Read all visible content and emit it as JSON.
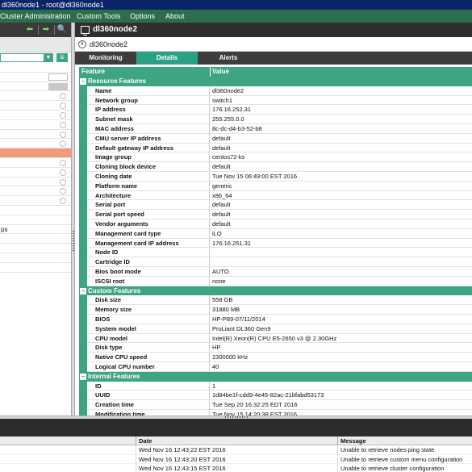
{
  "window": {
    "title": "dl360node1 - root@dl360node1"
  },
  "menubar": {
    "items": [
      "Cluster Administration",
      "Custom Tools",
      "Options",
      "About"
    ]
  },
  "left_panel": {
    "tree_partial_text": "ps"
  },
  "node": {
    "name": "dl360node2",
    "info_label": "dl360node2"
  },
  "tabs": [
    {
      "label": "Monitoring",
      "active": false
    },
    {
      "label": "Details",
      "active": true
    },
    {
      "label": "Alerts",
      "active": false
    }
  ],
  "grid": {
    "columns": [
      "Feature",
      "Value"
    ],
    "sections": [
      {
        "title": "Resource Features",
        "rows": [
          {
            "k": "Name",
            "v": "dl360node2"
          },
          {
            "k": "Network group",
            "v": "switch1"
          },
          {
            "k": "IP address",
            "v": "176.16.252.31"
          },
          {
            "k": "Subnet mask",
            "v": "255.255.0.0"
          },
          {
            "k": "MAC address",
            "v": "8c-dc-d4-b3-52-b8"
          },
          {
            "k": "CMU server IP address",
            "v": "default"
          },
          {
            "k": "Default gateway IP address",
            "v": "default"
          },
          {
            "k": "Image group",
            "v": "centos72-ks"
          },
          {
            "k": "Cloning block device",
            "v": "default"
          },
          {
            "k": "Cloning date",
            "v": "Tue Nov 15 06:49:00 EST 2016"
          },
          {
            "k": "Platform name",
            "v": "generic"
          },
          {
            "k": "Architecture",
            "v": "x86_64"
          },
          {
            "k": "Serial port",
            "v": "default"
          },
          {
            "k": "Serial port speed",
            "v": "default"
          },
          {
            "k": "Vendor arguments",
            "v": "default"
          },
          {
            "k": "Management card type",
            "v": "iLO"
          },
          {
            "k": "Management card IP address",
            "v": "176.16.251.31"
          },
          {
            "k": "Node ID",
            "v": ""
          },
          {
            "k": "Cartridge ID",
            "v": ""
          },
          {
            "k": "Bios boot mode",
            "v": "AUTO"
          },
          {
            "k": "ISCSI root",
            "v": "none"
          }
        ]
      },
      {
        "title": "Custom Features",
        "rows": [
          {
            "k": "Disk size",
            "v": "558 GB"
          },
          {
            "k": "Memory size",
            "v": "31880 MB"
          },
          {
            "k": "BIOS",
            "v": "HP-P89-07/11/2014"
          },
          {
            "k": "System model",
            "v": "ProLiant DL360 Gen9"
          },
          {
            "k": "CPU model",
            "v": "Intel(R) Xeon(R) CPU E5-2650 v3 @ 2.30GHz"
          },
          {
            "k": "Disk type",
            "v": "HP"
          },
          {
            "k": "Native CPU speed",
            "v": "2300000 kHz"
          },
          {
            "k": "Logical CPU number",
            "v": "40"
          }
        ]
      },
      {
        "title": "Internal Features",
        "rows": [
          {
            "k": "ID",
            "v": "1"
          },
          {
            "k": "UUID",
            "v": "1d84be1f-cdd9-4e45-82ac-21bfabd53173"
          },
          {
            "k": "Creation time",
            "v": "Tue Sep 20 16:32:25 EDT 2016"
          },
          {
            "k": "Modification time",
            "v": "Tue Nov 15 14:20:38 EST 2016"
          }
        ]
      }
    ]
  },
  "log": {
    "columns": [
      "Date",
      "Message"
    ],
    "rows": [
      {
        "date": "Wed Nov 16 12:43:22 EST 2016",
        "message": "Unable to retrieve nodes ping state"
      },
      {
        "date": "Wed Nov 16 12:43:20 EST 2016",
        "message": "Unable to retrieve custom menu configuration"
      },
      {
        "date": "Wed Nov 16 12:43:15 EST 2016",
        "message": "Unable to retrieve cluster configuration"
      }
    ]
  }
}
